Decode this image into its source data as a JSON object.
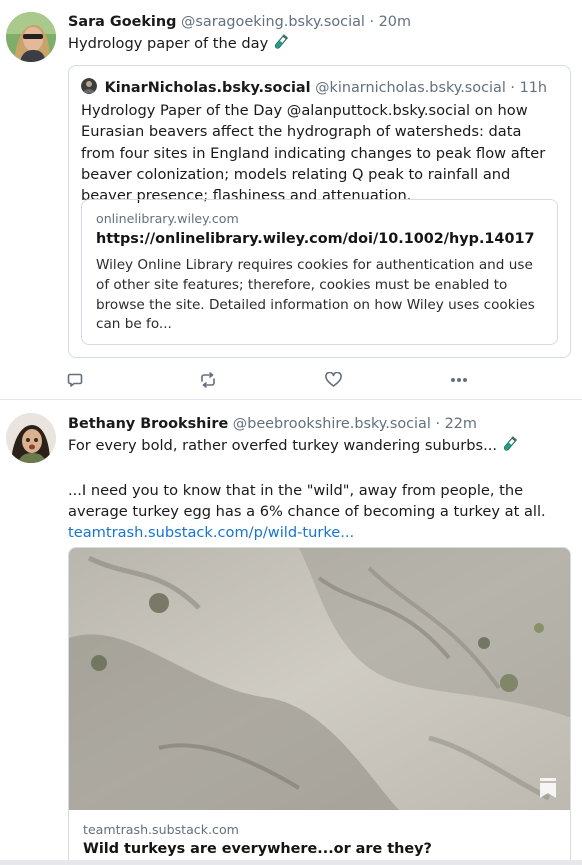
{
  "posts": [
    {
      "author": "Sara Goeking",
      "handle": "@saragoeking.bsky.social",
      "time": "· 20m",
      "text": "Hydrology paper of the day",
      "quote": {
        "author": "KinarNicholas.bsky.social",
        "handle": "@kinarnicholas.bsky.social",
        "time": "· 11h",
        "text": "Hydrology Paper of the Day @alanputtock.bsky.social on how Eurasian beavers affect the hydrograph of watersheds: data from four sites in England indicating changes to peak flow after beaver colonization; models relating Q peak to rainfall and beaver presence; flashiness and attenuation.",
        "link_card": {
          "domain": "onlinelibrary.wiley.com",
          "title": "https://onlinelibrary.wiley.com/doi/10.1002/hyp.14017",
          "description": "Wiley Online Library requires cookies for authentication and use of other site features; therefore, cookies must be enabled to browse the site. Detailed information on how Wiley uses cookies can be fo..."
        }
      },
      "actions": [
        "reply-icon",
        "repost-icon",
        "like-icon",
        "more-icon"
      ]
    },
    {
      "author": "Bethany Brookshire",
      "handle": "@beebrookshire.bsky.social",
      "time": "· 22m",
      "text_line1": "For every bold, rather overfed turkey wandering suburbs...",
      "text_line2": "...I need you to know that in the \"wild\", away from people, the average turkey egg has a 6% chance of becoming a turkey at all.",
      "link": "teamtrash.substack.com/p/wild-turke...",
      "embed": {
        "image_icon": "bookmark-icon",
        "domain": "teamtrash.substack.com",
        "title": "Wild turkeys are everywhere...or are they?"
      }
    }
  ],
  "colors": {
    "link": "#1575d1",
    "muted": "#63707e",
    "border": "#d6dbe1",
    "test_tube": "#1f9e84"
  }
}
